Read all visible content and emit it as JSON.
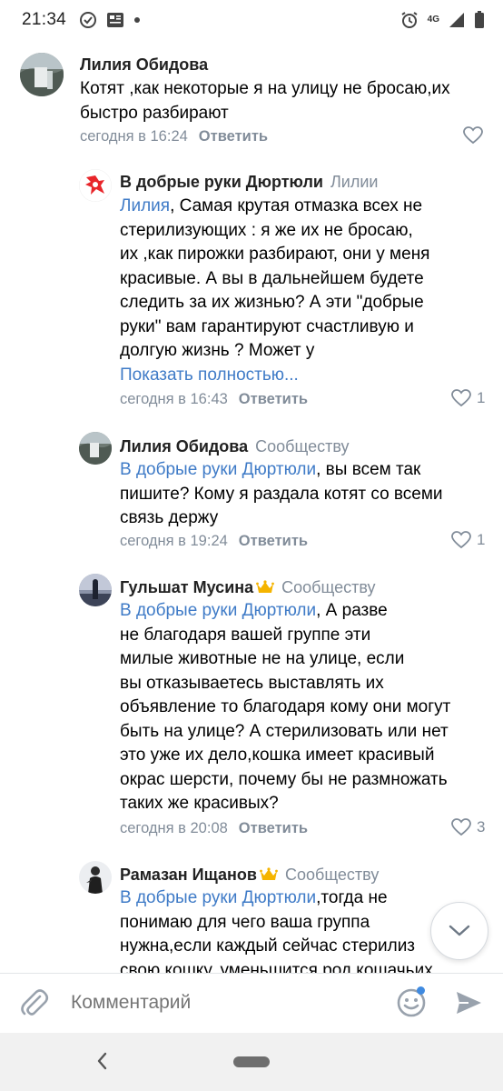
{
  "status_bar": {
    "time": "21:34",
    "network": "4G",
    "icons": [
      "sync-check-icon",
      "news-icon",
      "dots-icon",
      "alarm-icon",
      "signal-icon",
      "battery-icon"
    ]
  },
  "comments": [
    {
      "author": "Лилия Обидова",
      "reply_to": "",
      "crown": false,
      "lines": [
        [
          {
            "t": "Котят ,как некоторые я на улицу не бросаю,их"
          }
        ],
        [
          {
            "t": "быстро разбирают"
          }
        ]
      ],
      "show_more": "",
      "time": "сегодня в 16:24",
      "reply_label": "Ответить",
      "likes": ""
    },
    {
      "author": "В добрые руки  Дюртюли",
      "reply_to": "Лилии",
      "crown": false,
      "lines": [
        [
          {
            "t": "Лилия",
            "m": true
          },
          {
            "t": ", Самая крутая отмазка всех не"
          }
        ],
        [
          {
            "t": "стерилизующих : я же их не бросаю,"
          }
        ],
        [
          {
            "t": "их ,как пирожки разбирают, они у меня"
          }
        ],
        [
          {
            "t": "красивые. А вы в дальнейшем будете"
          }
        ],
        [
          {
            "t": "следить за их жизнью? А эти \"добрые"
          }
        ],
        [
          {
            "t": "руки\" вам гарантируют счастливую и"
          }
        ],
        [
          {
            "t": "долгую жизнь ? Может у"
          }
        ]
      ],
      "show_more": "Показать полностью...",
      "time": "сегодня в 16:43",
      "reply_label": "Ответить",
      "likes": "1"
    },
    {
      "author": "Лилия Обидова",
      "reply_to": "Сообществу",
      "crown": false,
      "lines": [
        [
          {
            "t": "В добрые руки  Дюртюли",
            "m": true
          },
          {
            "t": ", вы всем так"
          }
        ],
        [
          {
            "t": "пишите? Кому я раздала котят со всеми"
          }
        ],
        [
          {
            "t": "связь держу"
          }
        ]
      ],
      "show_more": "",
      "time": "сегодня в 19:24",
      "reply_label": "Ответить",
      "likes": "1"
    },
    {
      "author": "Гульшат Мусина",
      "reply_to": "Сообществу",
      "crown": true,
      "lines": [
        [
          {
            "t": "В добрые руки  Дюртюли",
            "m": true
          },
          {
            "t": ",  А разве"
          }
        ],
        [
          {
            "t": "не благодаря вашей группе эти"
          }
        ],
        [
          {
            "t": "милые животные не на улице, если"
          }
        ],
        [
          {
            "t": "вы отказываетесь выставлять их"
          }
        ],
        [
          {
            "t": "объявление то благодаря кому они могут"
          }
        ],
        [
          {
            "t": "быть на улице? А стерилизовать или нет"
          }
        ],
        [
          {
            "t": "это уже их дело,кошка имеет красивый"
          }
        ],
        [
          {
            "t": "окрас шерсти, почему бы не размножать"
          }
        ],
        [
          {
            "t": "таких же красивых?"
          }
        ]
      ],
      "show_more": "",
      "time": "сегодня в 20:08",
      "reply_label": "Ответить",
      "likes": "3"
    },
    {
      "author": "Рамазан Ищанов",
      "reply_to": "Сообществу",
      "crown": true,
      "lines": [
        [
          {
            "t": "В добрые руки  Дюртюли",
            "m": true
          },
          {
            "t": ",тогда не"
          }
        ],
        [
          {
            "t": "понимаю для чего ваша группа"
          }
        ],
        [
          {
            "t": "нужна,если каждый сейчас стерилиз"
          }
        ],
        [
          {
            "t": "свою кошку, уменьшится род кошачьих"
          }
        ]
      ],
      "show_more": "",
      "time": "",
      "reply_label": "",
      "likes": ""
    }
  ],
  "composer": {
    "placeholder": "Комментарий"
  },
  "colors": {
    "accent": "#3f7bc7",
    "meta": "#818c99",
    "brand_red": "#e8252a"
  }
}
